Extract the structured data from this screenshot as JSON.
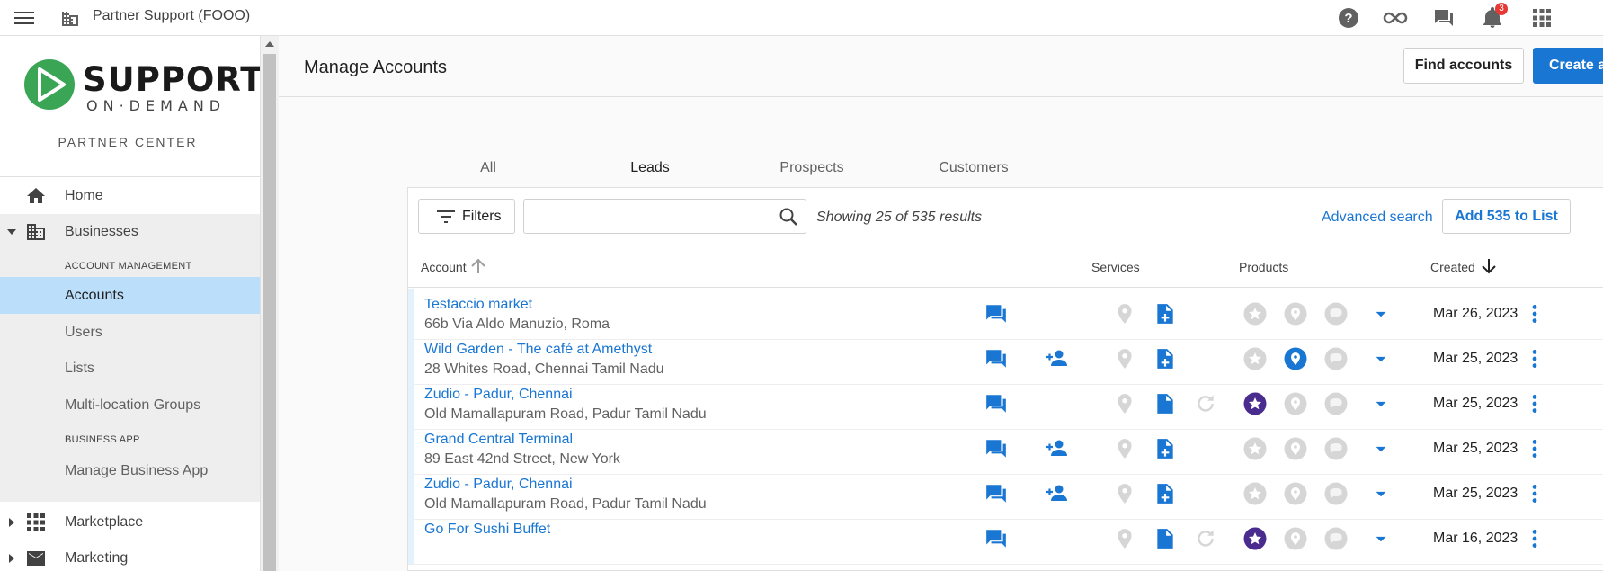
{
  "topbar": {
    "org_name": "Partner Support (FOOO)",
    "notification_count": "3",
    "icons": [
      "menu-icon",
      "business-icon",
      "help-icon",
      "infinity-icon",
      "chat-icon",
      "bell-icon",
      "apps-grid-icon"
    ]
  },
  "sidebar": {
    "brand_main": "SUPPORT",
    "brand_sub": "ON·DEMAND",
    "center_label": "PARTNER CENTER",
    "home": "Home",
    "businesses": "Businesses",
    "account_management_heading": "ACCOUNT MANAGEMENT",
    "accounts": "Accounts",
    "users": "Users",
    "lists": "Lists",
    "multi_location": "Multi-location Groups",
    "business_app_heading": "BUSINESS APP",
    "manage_business_app": "Manage Business App",
    "marketplace": "Marketplace",
    "marketing": "Marketing"
  },
  "main": {
    "title": "Manage Accounts",
    "find_accounts": "Find accounts",
    "create_account": "Create a",
    "tabs": [
      {
        "label": "All",
        "active": false
      },
      {
        "label": "Leads",
        "active": true
      },
      {
        "label": "Prospects",
        "active": false
      },
      {
        "label": "Customers",
        "active": false
      }
    ],
    "filters": "Filters",
    "search": {
      "value": "",
      "placeholder": ""
    },
    "results": "Showing 25 of 535 results",
    "advanced_search": "Advanced search",
    "add_to_list": "Add 535 to List",
    "columns": {
      "account": "Account",
      "services": "Services",
      "products": "Products",
      "created": "Created"
    }
  },
  "rows": [
    {
      "name": "Testaccio market",
      "address": "66b Via Aldo Manuzio, Roma",
      "created": "Mar 26, 2023"
    },
    {
      "name": "Wild Garden - The café at Amethyst",
      "address": "28 Whites Road, Chennai Tamil Nadu",
      "created": "Mar 25, 2023"
    },
    {
      "name": "Zudio - Padur, Chennai",
      "address": "Old Mamallapuram Road, Padur Tamil Nadu",
      "created": "Mar 25, 2023"
    },
    {
      "name": "Grand Central Terminal",
      "address": "89 East 42nd Street, New York",
      "created": "Mar 25, 2023"
    },
    {
      "name": "Zudio - Padur, Chennai",
      "address": "Old Mamallapuram Road, Padur Tamil Nadu",
      "created": "Mar 25, 2023"
    },
    {
      "name": "Go For Sushi Buffet",
      "address": "",
      "created": "Mar 16, 2023"
    }
  ],
  "colors": {
    "primary": "#1976d2",
    "active_nav": "#bbdefb",
    "product_purple": "#4a2c8f",
    "inactive_grey": "#d6d6d6"
  }
}
